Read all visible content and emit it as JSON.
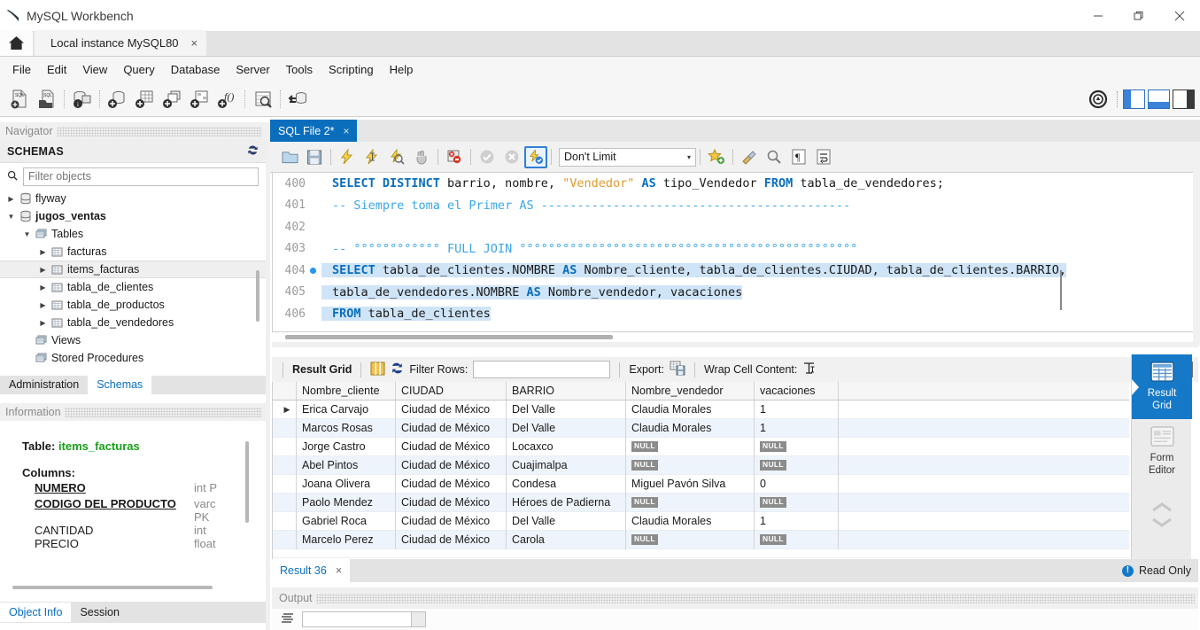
{
  "window": {
    "title": "MySQL Workbench",
    "controls": {
      "minimize": "—",
      "restore": "❐",
      "close": "✕"
    }
  },
  "main_tabs": [
    {
      "label": "Local instance MySQL80",
      "close": "×",
      "active": true
    }
  ],
  "menu": [
    "File",
    "Edit",
    "View",
    "Query",
    "Database",
    "Server",
    "Tools",
    "Scripting",
    "Help"
  ],
  "toolbar": {
    "icons": [
      "new-sql-tab-icon",
      "open-sql-script-icon",
      "connection-info-icon",
      "new-schema-icon",
      "new-table-icon",
      "new-view-icon",
      "new-procedure-icon",
      "new-function-icon",
      "search-table-data-icon",
      "reconnect-server-icon"
    ],
    "right_icons": [
      "admin-toggle-icon",
      "layout-sidebar-icon",
      "layout-output-icon",
      "layout-secondary-sidebar-icon"
    ]
  },
  "navigator": {
    "dock_title": "Navigator",
    "section_title": "SCHEMAS",
    "refresh_icon": "refresh-icon",
    "filter_placeholder": "Filter objects",
    "filter_value": "",
    "search_icon": "search-icon",
    "tree": [
      {
        "label": "flyway",
        "indent": 0,
        "arrow": "right",
        "icon": "schema-icon",
        "bold": false,
        "selected": false
      },
      {
        "label": "jugos_ventas",
        "indent": 0,
        "arrow": "down",
        "icon": "schema-icon",
        "bold": true,
        "selected": false
      },
      {
        "label": "Tables",
        "indent": 1,
        "arrow": "down",
        "icon": "folder-icon",
        "bold": false,
        "selected": false
      },
      {
        "label": "facturas",
        "indent": 2,
        "arrow": "right",
        "icon": "table-icon",
        "bold": false,
        "selected": false
      },
      {
        "label": "items_facturas",
        "indent": 2,
        "arrow": "right",
        "icon": "table-icon",
        "bold": false,
        "selected": true
      },
      {
        "label": "tabla_de_clientes",
        "indent": 2,
        "arrow": "right",
        "icon": "table-icon",
        "bold": false,
        "selected": false
      },
      {
        "label": "tabla_de_productos",
        "indent": 2,
        "arrow": "right",
        "icon": "table-icon",
        "bold": false,
        "selected": false
      },
      {
        "label": "tabla_de_vendedores",
        "indent": 2,
        "arrow": "right",
        "icon": "table-icon",
        "bold": false,
        "selected": false
      },
      {
        "label": "Views",
        "indent": 1,
        "arrow": "none",
        "icon": "folder-icon",
        "bold": false,
        "selected": false
      },
      {
        "label": "Stored Procedures",
        "indent": 1,
        "arrow": "none",
        "icon": "folder-icon",
        "bold": false,
        "selected": false
      }
    ],
    "tabs": [
      {
        "label": "Administration",
        "active": false
      },
      {
        "label": "Schemas",
        "active": true
      }
    ]
  },
  "information": {
    "dock_title": "Information",
    "table_label": "Table:",
    "table_name": "items_facturas",
    "columns_label": "Columns:",
    "columns": [
      {
        "name": "NUMERO",
        "type": "int P",
        "key": true
      },
      {
        "name": "CODIGO  DEL  PRODUCTO",
        "type": "varc",
        "key": true
      },
      {
        "name": "",
        "type": "PK",
        "key": false
      },
      {
        "name": "CANTIDAD",
        "type": "int",
        "key": false
      },
      {
        "name": "PRECIO",
        "type": "float",
        "key": false
      }
    ],
    "tabs": [
      {
        "label": "Object Info",
        "active": true
      },
      {
        "label": "Session",
        "active": false
      }
    ]
  },
  "editor": {
    "tab": {
      "label": "SQL File 2*",
      "close": "×"
    },
    "toolbar": {
      "icons": [
        "open-file-icon",
        "save-file-icon",
        "execute-icon",
        "execute-current-icon",
        "explain-icon",
        "stop-icon",
        "toggle-stop-on-error-icon",
        "commit-icon",
        "rollback-icon",
        "toggle-autocommit-icon"
      ],
      "limit_value": "Don't Limit",
      "limit_caret": "▾",
      "right_icons": [
        "snippet-save-icon",
        "beautify-icon",
        "find-icon",
        "toggle-invisible-chars-icon",
        "wrap-lines-icon"
      ]
    },
    "lines": [
      {
        "number": "400",
        "breakpoint": false,
        "highlight": false,
        "tokens": [
          {
            "t": "SELECT DISTINCT ",
            "c": "kw"
          },
          {
            "t": "barrio, nombre, ",
            "c": "plain"
          },
          {
            "t": "\"Vendedor\"",
            "c": "str"
          },
          {
            "t": " ",
            "c": "plain"
          },
          {
            "t": "AS",
            "c": "kw"
          },
          {
            "t": " tipo_Vendedor ",
            "c": "plain"
          },
          {
            "t": "FROM",
            "c": "kw"
          },
          {
            "t": " tabla_de_vendedores;",
            "c": "plain"
          }
        ]
      },
      {
        "number": "401",
        "breakpoint": false,
        "highlight": false,
        "tokens": [
          {
            "t": "-- Siempre toma el Primer AS -------------------------------------------",
            "c": "cmt"
          }
        ]
      },
      {
        "number": "402",
        "breakpoint": false,
        "highlight": false,
        "tokens": [
          {
            "t": "",
            "c": "plain"
          }
        ]
      },
      {
        "number": "403",
        "breakpoint": false,
        "highlight": false,
        "tokens": [
          {
            "t": "-- °°°°°°°°°°°° FULL JOIN °°°°°°°°°°°°°°°°°°°°°°°°°°°°°°°°°°°°°°°°°°°°°°°",
            "c": "cmt"
          }
        ]
      },
      {
        "number": "404",
        "breakpoint": true,
        "highlight": true,
        "tokens": [
          {
            "t": "SELECT",
            "c": "kw"
          },
          {
            "t": " tabla_de_clientes.NOMBRE ",
            "c": "plain"
          },
          {
            "t": "AS",
            "c": "kw"
          },
          {
            "t": " Nombre_cliente, tabla_de_clientes.CIUDAD, tabla_de_clientes.BARRIO,",
            "c": "plain"
          }
        ]
      },
      {
        "number": "405",
        "breakpoint": false,
        "highlight": true,
        "tokens": [
          {
            "t": "tabla_de_vendedores.NOMBRE ",
            "c": "plain"
          },
          {
            "t": "AS",
            "c": "kw"
          },
          {
            "t": " Nombre_vendedor, vacaciones",
            "c": "plain"
          }
        ]
      },
      {
        "number": "406",
        "breakpoint": false,
        "highlight": true,
        "tokens": [
          {
            "t": "FROM",
            "c": "kw"
          },
          {
            "t": " tabla_de_clientes",
            "c": "plain"
          }
        ]
      }
    ]
  },
  "result_grid": {
    "label": "Result Grid",
    "grid_icon": "grid-view-icon",
    "refresh_icon": "refresh-grid-icon",
    "filter_label": "Filter Rows:",
    "filter_value": "",
    "export_label": "Export:",
    "export_icon": "export-icon",
    "wrap_label": "Wrap Cell Content:",
    "wrap_icon": "wrap-text-icon",
    "panel_toggle_icon": "toggle-side-panel-icon",
    "columns": [
      "Nombre_cliente",
      "CIUDAD",
      "BARRIO",
      "Nombre_vendedor",
      "vacaciones"
    ],
    "rows": [
      {
        "marker": "▶",
        "cells": [
          "Erica Carvajo",
          "Ciudad de México",
          "Del Valle",
          "Claudia Morales",
          "1"
        ]
      },
      {
        "marker": "",
        "cells": [
          "Marcos Rosas",
          "Ciudad de México",
          "Del Valle",
          "Claudia Morales",
          "1"
        ]
      },
      {
        "marker": "",
        "cells": [
          "Jorge Castro",
          "Ciudad de México",
          "Locaxco",
          "NULL",
          "NULL"
        ]
      },
      {
        "marker": "",
        "cells": [
          "Abel Pintos",
          "Ciudad de México",
          "Cuajimalpa",
          "NULL",
          "NULL"
        ]
      },
      {
        "marker": "",
        "cells": [
          "Joana Olivera",
          "Ciudad de México",
          "Condesa",
          "Miguel Pavón Silva",
          "0"
        ]
      },
      {
        "marker": "",
        "cells": [
          "Paolo Mendez",
          "Ciudad de México",
          "Héroes de Padierna",
          "NULL",
          "NULL"
        ]
      },
      {
        "marker": "",
        "cells": [
          "Gabriel Roca",
          "Ciudad de México",
          "Del Valle",
          "Claudia Morales",
          "1"
        ]
      },
      {
        "marker": "",
        "cells": [
          "Marcelo Perez",
          "Ciudad de México",
          "Carola",
          "NULL",
          "NULL"
        ]
      }
    ],
    "null_text": "NULL"
  },
  "side_panel": {
    "items": [
      {
        "label": "Result\nGrid",
        "icon": "result-grid-icon",
        "active": true
      },
      {
        "label": "Form\nEditor",
        "icon": "form-editor-icon",
        "active": false
      }
    ],
    "up_arrow": "⌃",
    "down_arrow": "⌄"
  },
  "result_tabs": [
    {
      "label": "Result 36",
      "close": "×",
      "active": true
    }
  ],
  "status": {
    "read_only": "Read Only",
    "info_icon": "info-icon",
    "info_glyph": "!"
  },
  "output": {
    "dock_title": "Output",
    "icon": "output-list-icon",
    "combo_value": ""
  },
  "colors": {
    "accent": "#0a6ebd",
    "tab_active": "#1679c8",
    "selection": "#cfe4f7",
    "keyword": "#0a6ebd",
    "comment": "#3ba6e8",
    "string": "#e09a2a",
    "null_badge": "#8c8c8c",
    "schema_green": "#18a018"
  }
}
